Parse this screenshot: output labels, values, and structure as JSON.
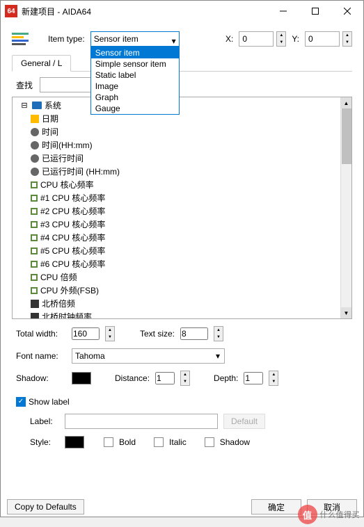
{
  "window": {
    "title": "新建项目 - AIDA64",
    "app_icon_text": "64"
  },
  "top": {
    "item_type_label": "Item type:",
    "item_type_value": "Sensor item",
    "options": [
      "Sensor item",
      "Simple sensor item",
      "Static label",
      "Image",
      "Graph",
      "Gauge"
    ],
    "x_label": "X:",
    "x_value": "0",
    "y_label": "Y:",
    "y_value": "0"
  },
  "tab": {
    "label": "General / L"
  },
  "search": {
    "label": "查找"
  },
  "tree": {
    "root": "系统",
    "items": [
      {
        "icon": "sys",
        "text": "日期"
      },
      {
        "icon": "clock",
        "text": "时间"
      },
      {
        "icon": "clock",
        "text": "时间(HH:mm)"
      },
      {
        "icon": "clock",
        "text": "已运行时间"
      },
      {
        "icon": "clock",
        "text": "已运行时间 (HH:mm)"
      },
      {
        "icon": "box",
        "text": "CPU 核心频率"
      },
      {
        "icon": "box",
        "text": "#1 CPU 核心频率"
      },
      {
        "icon": "box",
        "text": "#2 CPU 核心频率"
      },
      {
        "icon": "box",
        "text": "#3 CPU 核心频率"
      },
      {
        "icon": "box",
        "text": "#4 CPU 核心频率"
      },
      {
        "icon": "box",
        "text": "#5 CPU 核心频率"
      },
      {
        "icon": "box",
        "text": "#6 CPU 核心频率"
      },
      {
        "icon": "box",
        "text": "CPU 倍频"
      },
      {
        "icon": "box",
        "text": "CPU 外频(FSB)"
      },
      {
        "icon": "chip",
        "text": "北桥倍频"
      },
      {
        "icon": "chip",
        "text": "北桥时钟频率"
      }
    ]
  },
  "form": {
    "total_width_label": "Total width:",
    "total_width_value": "160",
    "text_size_label": "Text size:",
    "text_size_value": "8",
    "font_name_label": "Font name:",
    "font_name_value": "Tahoma",
    "shadow_label": "Shadow:",
    "distance_label": "Distance:",
    "distance_value": "1",
    "depth_label": "Depth:",
    "depth_value": "1",
    "show_label": "Show label",
    "label_label": "Label:",
    "default_btn": "Default",
    "style_label": "Style:",
    "bold": "Bold",
    "italic": "Italic",
    "shadow_cb": "Shadow"
  },
  "footer": {
    "copy": "Copy to Defaults",
    "ok": "确定",
    "cancel": "取消"
  },
  "watermark": {
    "badge": "值",
    "text": "什么值得买"
  },
  "colors": {
    "accent": "#0078d4",
    "black": "#000000"
  }
}
